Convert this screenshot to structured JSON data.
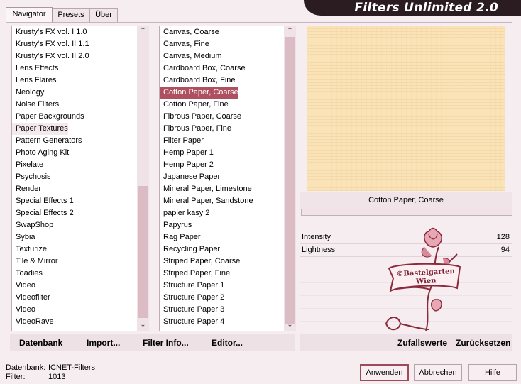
{
  "app": {
    "title": "Filters Unlimited 2.0"
  },
  "tabs": [
    "Navigator",
    "Presets",
    "Über"
  ],
  "categories": {
    "items": [
      "Krusty's FX vol. I 1.0",
      "Krusty's FX vol. II 1.1",
      "Krusty's FX vol. II 2.0",
      "Lens Effects",
      "Lens Flares",
      "Neology",
      "Noise Filters",
      "Paper Backgrounds",
      "Paper Textures",
      "Pattern Generators",
      "Photo Aging Kit",
      "Pixelate",
      "Psychosis",
      "Render",
      "Special Effects 1",
      "Special Effects 2",
      "SwapShop",
      "Sybia",
      "Texturize",
      "Tile & Mirror",
      "Toadies",
      "Video",
      "Videofilter",
      "Video",
      "VideoRave"
    ],
    "selected": "Paper Textures"
  },
  "filters": {
    "items": [
      "Canvas, Coarse",
      "Canvas, Fine",
      "Canvas, Medium",
      "Cardboard Box, Coarse",
      "Cardboard Box, Fine",
      "Cotton Paper, Coarse",
      "Cotton Paper, Fine",
      "Fibrous Paper, Coarse",
      "Fibrous Paper, Fine",
      "Filter Paper",
      "Hemp Paper 1",
      "Hemp Paper 2",
      "Japanese Paper",
      "Mineral Paper, Limestone",
      "Mineral Paper, Sandstone",
      "papier kasy 2",
      "Papyrus",
      "Rag Paper",
      "Recycling Paper",
      "Striped Paper, Coarse",
      "Striped Paper, Fine",
      "Structure Paper 1",
      "Structure Paper 2",
      "Structure Paper 3",
      "Structure Paper 4"
    ],
    "selected": "Cotton Paper, Coarse"
  },
  "preview": {
    "filter_name": "Cotton Paper, Coarse",
    "color": "#fbe3b8"
  },
  "controls": [
    {
      "label": "Intensity",
      "value": "128"
    },
    {
      "label": "Lightness",
      "value": "94"
    }
  ],
  "left_actions": {
    "database": "Datenbank",
    "import": "Import...",
    "filter_info": "Filter Info...",
    "editor": "Editor..."
  },
  "right_actions": {
    "random": "Zufallswerte",
    "reset": "Zurücksetzen"
  },
  "status": {
    "database_label": "Datenbank:",
    "database_value": "ICNET-Filters",
    "filter_label": "Filter:",
    "filter_value": "1013"
  },
  "buttons": {
    "apply": "Anwenden",
    "cancel": "Abbrechen",
    "help": "Hilfe"
  },
  "watermark": {
    "line1": "©Bastelgarten",
    "line2": "Wien"
  },
  "colors": {
    "accent": "#ae5060",
    "background": "#f6edf0",
    "title_bar": "#2b1c21"
  }
}
